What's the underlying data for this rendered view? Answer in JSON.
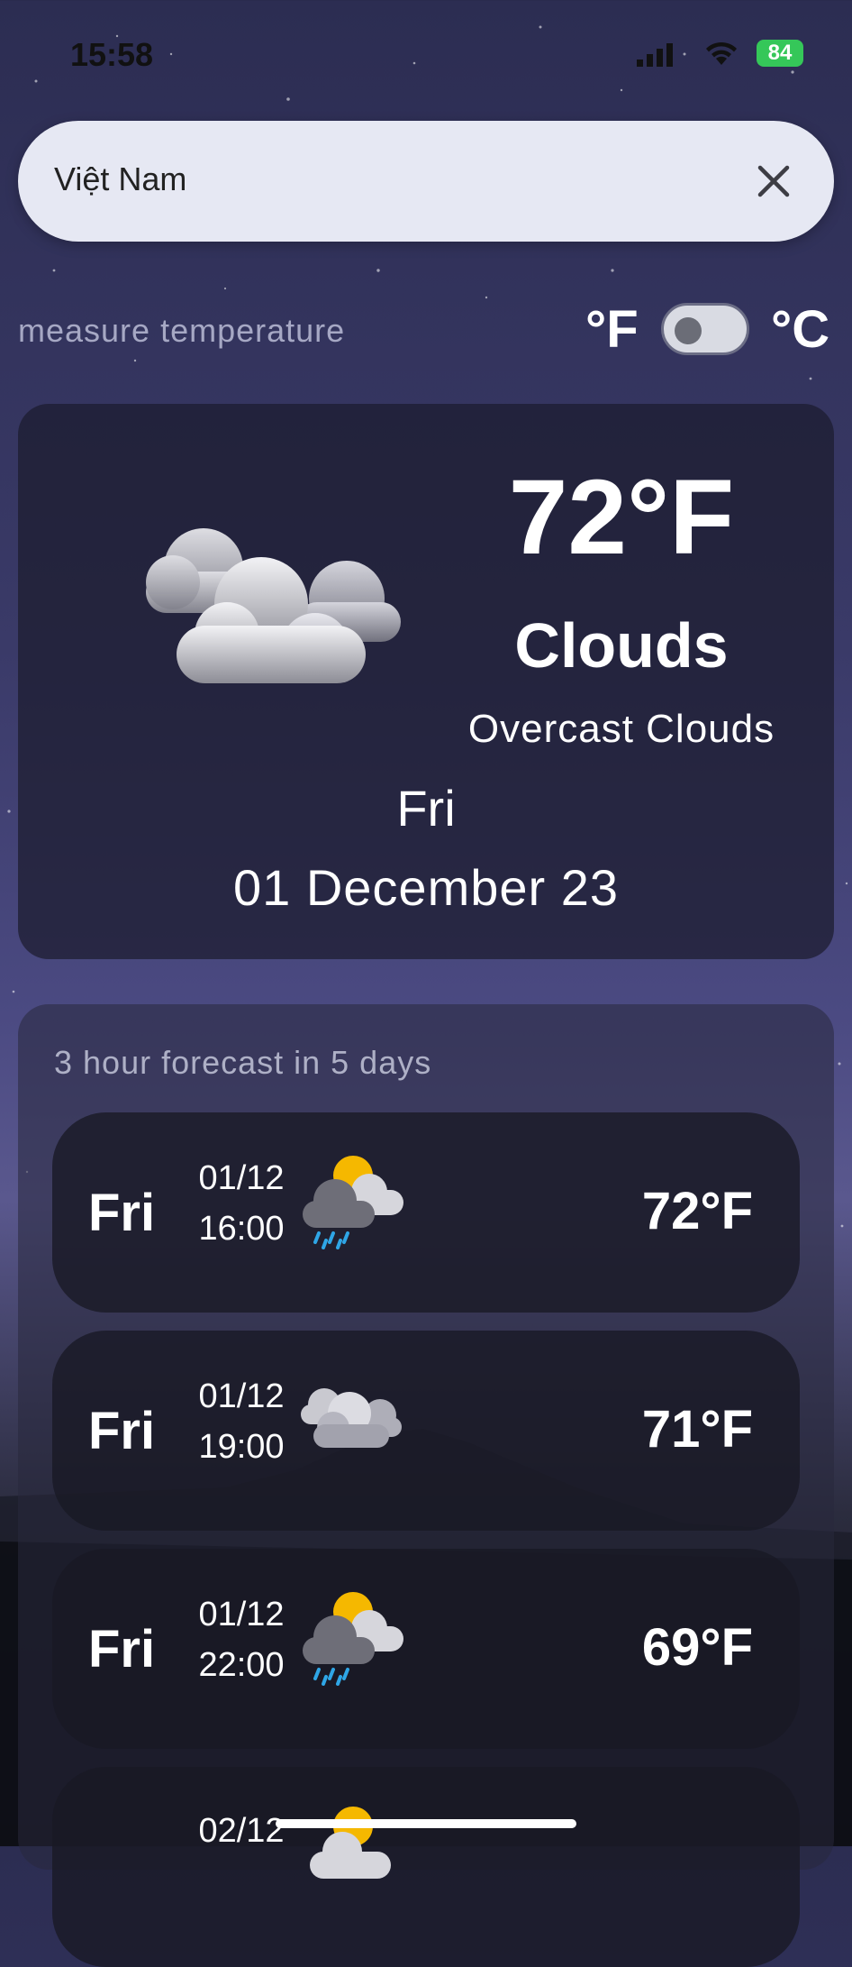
{
  "status_bar": {
    "time": "15:58",
    "battery": "84"
  },
  "search": {
    "value": "Việt Nam"
  },
  "measure": {
    "label": "measure temperature",
    "unit_f": "°F",
    "unit_c": "°C",
    "celsius_enabled": false
  },
  "current": {
    "temperature": "72°F",
    "main": "Clouds",
    "description": "Overcast Clouds",
    "day": "Fri",
    "date": "01 December 23",
    "icon": "clouds-icon"
  },
  "forecast": {
    "title": "3 hour forecast in 5 days",
    "items": [
      {
        "day": "Fri",
        "date": "01/12",
        "time": "16:00",
        "temp": "72°F",
        "icon": "sun-rain-cloud-icon"
      },
      {
        "day": "Fri",
        "date": "01/12",
        "time": "19:00",
        "temp": "71°F",
        "icon": "clouds-icon"
      },
      {
        "day": "Fri",
        "date": "01/12",
        "time": "22:00",
        "temp": "69°F",
        "icon": "sun-rain-cloud-icon"
      },
      {
        "day": "",
        "date": "02/12",
        "time": "",
        "temp": "",
        "icon": "sun-cloud-icon"
      }
    ]
  },
  "colors": {
    "accent_sun": "#f5b800",
    "rain": "#2fa6e6",
    "toggle_track": "#d9dbe3",
    "search_bg": "#e6e8f3"
  }
}
